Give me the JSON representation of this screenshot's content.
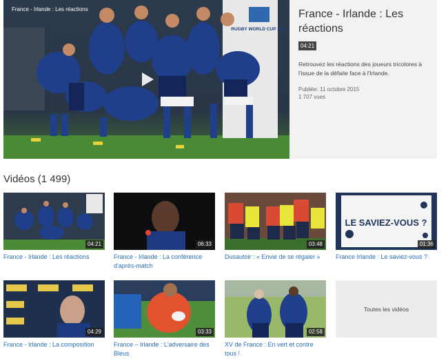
{
  "featured": {
    "caption": "France - Irlande : Les réactions",
    "title": "France - Irlande : Les réactions",
    "duration": "04:21",
    "description": "Retrouvez les réactions des joueurs tricolores à l'issue de la défaite face à l'Irlande.",
    "date": "Publiée: 11 octobre 2015",
    "views": "1 707 vues",
    "overlay_brand": "RUGBY WORLD CUP 2015",
    "icons": [
      "play-icon"
    ]
  },
  "section": {
    "title": "Vidéos (1 499)"
  },
  "videos": [
    {
      "title": "France - Irlande : Les réactions",
      "duration": "04:21"
    },
    {
      "title": "France - Irlande : La conférence d'après-match",
      "duration": "06:33"
    },
    {
      "title": "Dusautoir : « Envie de se régaler »",
      "duration": "03:48"
    },
    {
      "title": "France Irlande : Le saviez-vous ?",
      "duration": "01:36",
      "overlay_text": "LE SAVIEZ-VOUS ?"
    },
    {
      "title": "France - Irlande : La composition",
      "duration": "04:29"
    },
    {
      "title": "France – Irlande : L'adversaire des Bleus",
      "duration": "03:33"
    },
    {
      "title": "XV de France : En vert et contre tous !",
      "duration": "02:58"
    }
  ],
  "all_videos_label": "Toutes les vidéos",
  "colors": {
    "link": "#2a6fb9",
    "french_blue": "#1f3f8a",
    "pitch_green": "#3f7a2e"
  }
}
